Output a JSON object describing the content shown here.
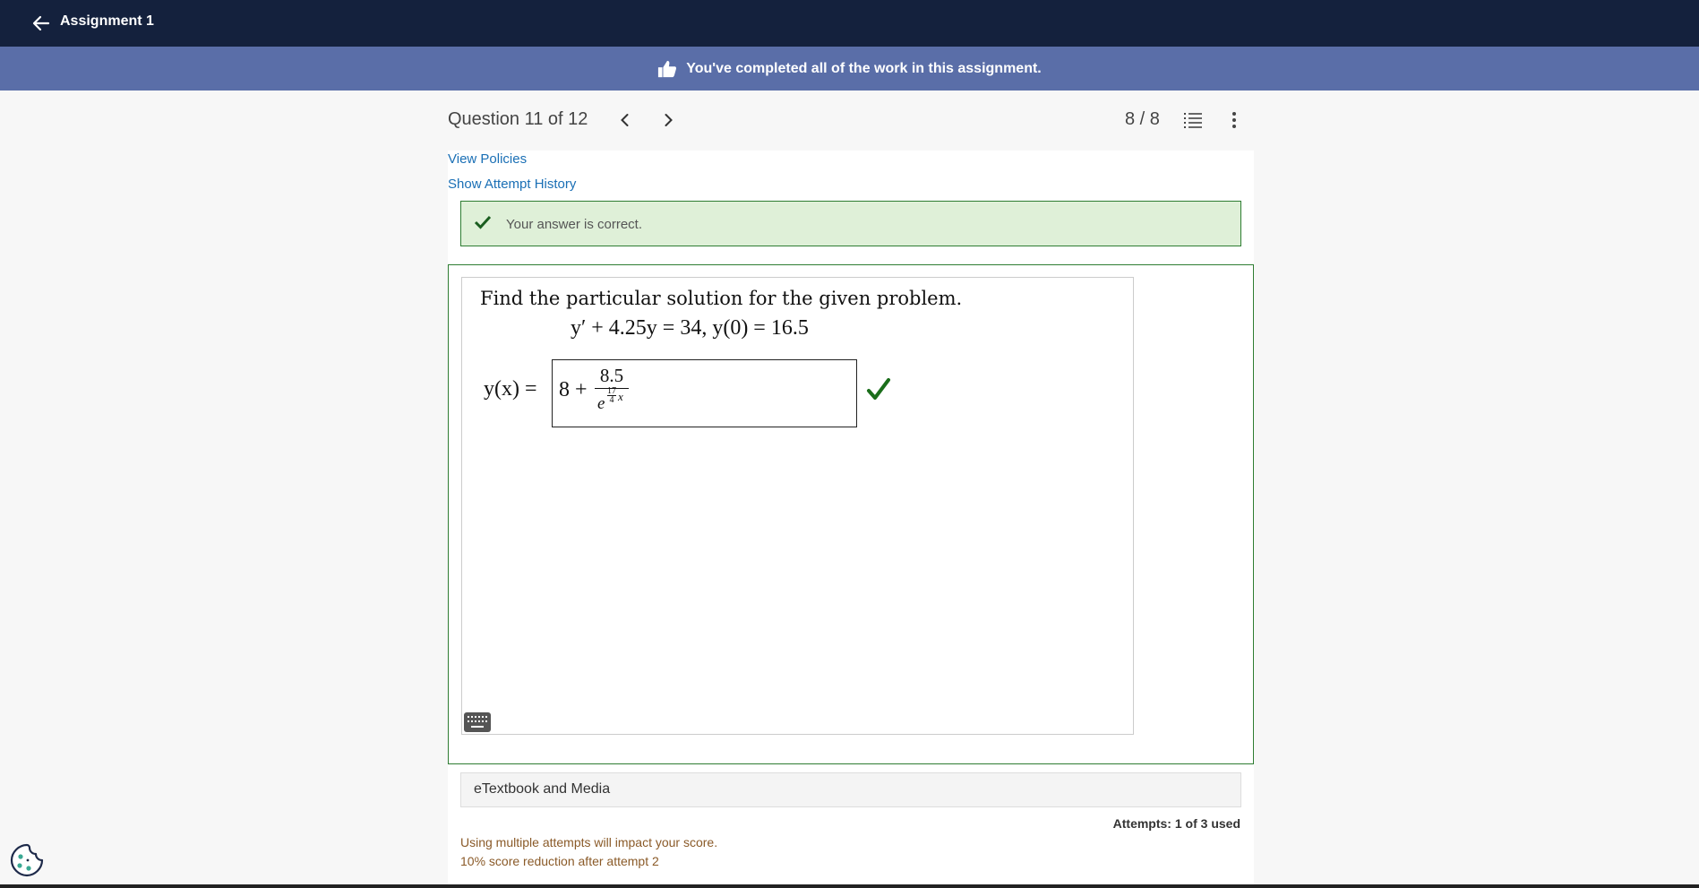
{
  "header": {
    "title": "Assignment 1",
    "back_icon": "arrow-left-icon"
  },
  "banner": {
    "message": "You've completed all of the work in this assignment.",
    "icon": "thumbs-up-icon"
  },
  "question_bar": {
    "title": "Question 11 of 12",
    "score": "8 / 8"
  },
  "links": {
    "policies": "View Policies",
    "attempt_history": "Show Attempt History"
  },
  "feedback": {
    "message": "Your answer is correct."
  },
  "question": {
    "prompt": "Find the particular solution for the given problem.",
    "equation": "y′ + 4.25y = 34,  y(0) = 16.5",
    "answer_label": "y(x) =",
    "answer": {
      "constant": "8 +",
      "numerator": "8.5",
      "exp_base": "e",
      "exp_num": "17",
      "exp_den": "4",
      "exp_var": "x"
    }
  },
  "resources": {
    "label": "eTextbook and Media"
  },
  "attempts": {
    "label": "Attempts: 1 of 3 used"
  },
  "notes": {
    "line1": "Using multiple attempts will impact your score.",
    "line2": "10% score reduction after attempt 2"
  },
  "colors": {
    "header_bg": "#14213d",
    "banner_bg": "#5a6ea8",
    "correct_green": "#2e7d32",
    "link_blue": "#1a6fb5",
    "note_brown": "#8a5a28"
  }
}
